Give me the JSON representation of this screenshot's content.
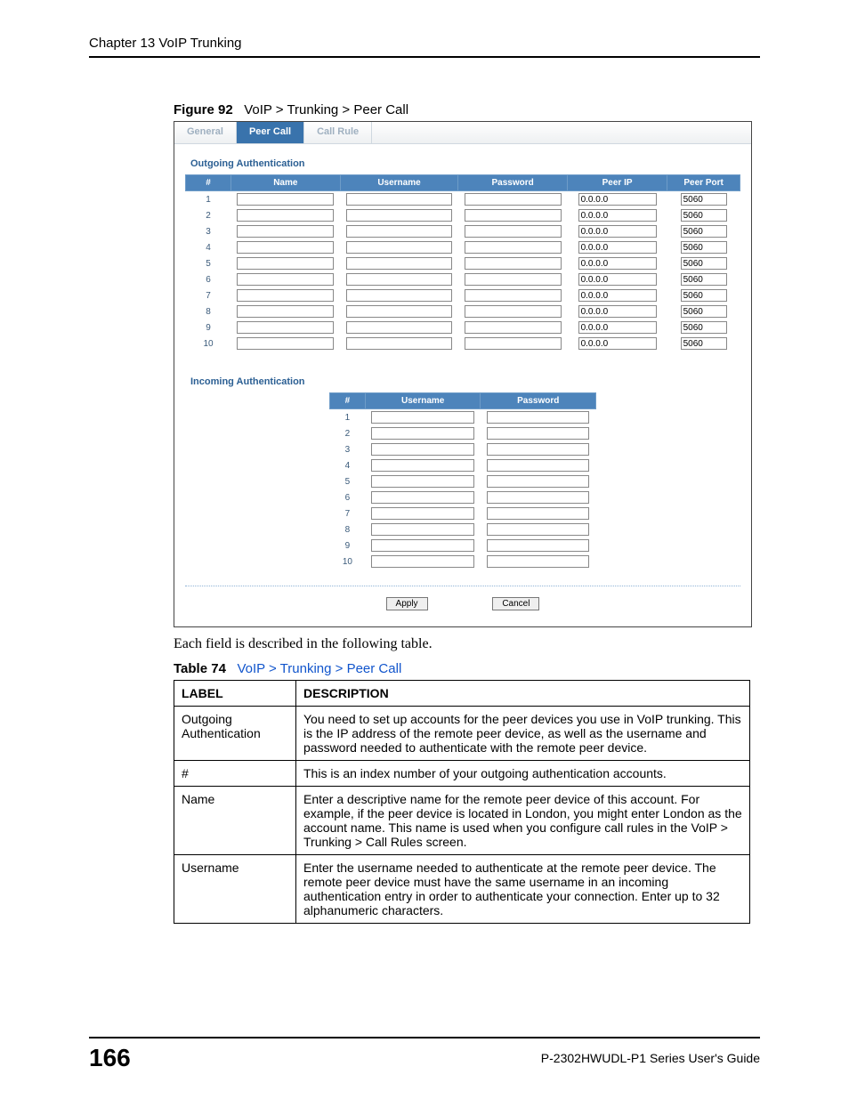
{
  "header": "Chapter 13 VoIP Trunking",
  "figure": {
    "label": "Figure 92",
    "title": "VoIP > Trunking  > Peer Call"
  },
  "tabs": {
    "general": "General",
    "peer_call": "Peer Call",
    "call_rule": "Call Rule"
  },
  "outgoing": {
    "title": "Outgoing Authentication",
    "columns": {
      "num": "#",
      "name": "Name",
      "user": "Username",
      "pass": "Password",
      "peerip": "Peer IP",
      "peerport": "Peer Port"
    },
    "rows": [
      {
        "n": "1",
        "name": "",
        "user": "",
        "pass": "",
        "ip": "0.0.0.0",
        "port": "5060"
      },
      {
        "n": "2",
        "name": "",
        "user": "",
        "pass": "",
        "ip": "0.0.0.0",
        "port": "5060"
      },
      {
        "n": "3",
        "name": "",
        "user": "",
        "pass": "",
        "ip": "0.0.0.0",
        "port": "5060"
      },
      {
        "n": "4",
        "name": "",
        "user": "",
        "pass": "",
        "ip": "0.0.0.0",
        "port": "5060"
      },
      {
        "n": "5",
        "name": "",
        "user": "",
        "pass": "",
        "ip": "0.0.0.0",
        "port": "5060"
      },
      {
        "n": "6",
        "name": "",
        "user": "",
        "pass": "",
        "ip": "0.0.0.0",
        "port": "5060"
      },
      {
        "n": "7",
        "name": "",
        "user": "",
        "pass": "",
        "ip": "0.0.0.0",
        "port": "5060"
      },
      {
        "n": "8",
        "name": "",
        "user": "",
        "pass": "",
        "ip": "0.0.0.0",
        "port": "5060"
      },
      {
        "n": "9",
        "name": "",
        "user": "",
        "pass": "",
        "ip": "0.0.0.0",
        "port": "5060"
      },
      {
        "n": "10",
        "name": "",
        "user": "",
        "pass": "",
        "ip": "0.0.0.0",
        "port": "5060"
      }
    ]
  },
  "incoming": {
    "title": "Incoming Authentication",
    "columns": {
      "num": "#",
      "user": "Username",
      "pass": "Password"
    },
    "rows": [
      {
        "n": "1",
        "user": "",
        "pass": ""
      },
      {
        "n": "2",
        "user": "",
        "pass": ""
      },
      {
        "n": "3",
        "user": "",
        "pass": ""
      },
      {
        "n": "4",
        "user": "",
        "pass": ""
      },
      {
        "n": "5",
        "user": "",
        "pass": ""
      },
      {
        "n": "6",
        "user": "",
        "pass": ""
      },
      {
        "n": "7",
        "user": "",
        "pass": ""
      },
      {
        "n": "8",
        "user": "",
        "pass": ""
      },
      {
        "n": "9",
        "user": "",
        "pass": ""
      },
      {
        "n": "10",
        "user": "",
        "pass": ""
      }
    ]
  },
  "buttons": {
    "apply": "Apply",
    "cancel": "Cancel"
  },
  "following": "Each field is described in the following table.",
  "table74": {
    "label": "Table 74",
    "title": "VoIP > Trunking > Peer Call",
    "head_label": "LABEL",
    "head_desc": "DESCRIPTION",
    "rows": [
      {
        "label": "Outgoing Authentication",
        "desc": "You need to set up accounts for the peer devices you use in VoIP trunking. This is the IP address of the remote peer device, as well as the username and password needed to authenticate with the remote peer device."
      },
      {
        "label": "#",
        "desc": "This is an index number of your outgoing authentication accounts."
      },
      {
        "label": "Name",
        "desc": "Enter a descriptive name for the remote peer device of this account. For example, if the peer device is located in London, you might enter London as the account name. This name is used when you configure call rules in the VoIP > Trunking > Call Rules screen."
      },
      {
        "label": "Username",
        "desc": "Enter the username needed to authenticate at the remote peer device. The remote peer device must have the same username in an incoming authentication entry in order to authenticate your connection. Enter up to 32 alphanumeric characters."
      }
    ]
  },
  "footer": {
    "page": "166",
    "guide": "P-2302HWUDL-P1 Series User's Guide"
  }
}
